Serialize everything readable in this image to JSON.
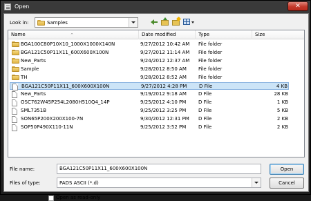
{
  "window": {
    "title": "Open",
    "close_glyph": "✕"
  },
  "lookin": {
    "label": "Look in:",
    "value": "Samples"
  },
  "toolbar": {
    "back_icon": "back-arrow-icon",
    "up_icon": "up-folder-icon",
    "new_icon": "new-folder-icon",
    "view_icon": "view-menu-icon"
  },
  "filelist": {
    "columns": {
      "name": "Name",
      "date": "Date modified",
      "type": "Type",
      "size": "Size"
    },
    "rows": [
      {
        "name": "BGA100C80P10X10_1000X1000X140N",
        "date": "9/27/2012 10:42 AM",
        "type": "File folder",
        "size": "",
        "kind": "folder"
      },
      {
        "name": "BGA121C50P11X11_600X600X100N",
        "date": "9/27/2012 11:14 AM",
        "type": "File folder",
        "size": "",
        "kind": "folder"
      },
      {
        "name": "New_Parts",
        "date": "9/24/2012 12:37 AM",
        "type": "File folder",
        "size": "",
        "kind": "folder"
      },
      {
        "name": "Sample",
        "date": "9/28/2012 8:50 AM",
        "type": "File folder",
        "size": "",
        "kind": "folder"
      },
      {
        "name": "TH",
        "date": "9/28/2012 8:52 AM",
        "type": "File folder",
        "size": "",
        "kind": "folder"
      },
      {
        "name": "BGA121C50P11X11_600X600X100N",
        "date": "9/27/2012 4:28 PM",
        "type": "D File",
        "size": "4 KB",
        "kind": "file",
        "selected": true
      },
      {
        "name": "New_Parts",
        "date": "9/19/2012 9:18 AM",
        "type": "D File",
        "size": "28 KB",
        "kind": "file"
      },
      {
        "name": "OSC762W45P254L2080H510Q4_14P",
        "date": "9/25/2012 4:10 PM",
        "type": "D File",
        "size": "1 KB",
        "kind": "file"
      },
      {
        "name": "SML7351B",
        "date": "9/25/2012 3:25 PM",
        "type": "D File",
        "size": "5 KB",
        "kind": "file"
      },
      {
        "name": "SON65P200X200X100-7N",
        "date": "9/30/2012 12:31 PM",
        "type": "D File",
        "size": "2 KB",
        "kind": "file"
      },
      {
        "name": "SOP50P490X110-11N",
        "date": "9/25/2012 3:52 PM",
        "type": "D File",
        "size": "2 KB",
        "kind": "file"
      }
    ]
  },
  "filename": {
    "label": "File name:",
    "value": "BGA121C50P11X11_600X600X100N"
  },
  "filetype": {
    "label": "Files of type:",
    "value": "PADS ASCII (*.d)"
  },
  "buttons": {
    "open": "Open",
    "cancel": "Cancel"
  },
  "readonly": {
    "label": "Open as read-only",
    "checked": false
  },
  "colors": {
    "selection": "#cce4f7",
    "close": "#c4392b",
    "folder": "#e7c354"
  }
}
